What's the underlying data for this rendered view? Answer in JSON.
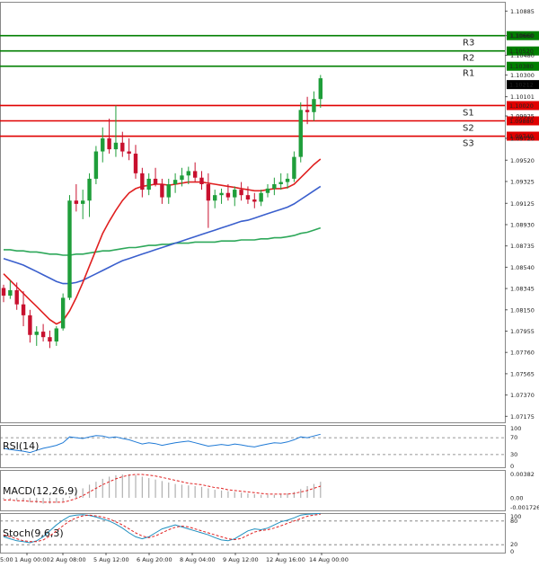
{
  "chart_data": {
    "type": "candlestick",
    "symbol": "EUR/USD",
    "y_ticks": [
      "1.10885",
      "1.10660",
      "1.10480",
      "1.10300",
      "1.10101",
      "1.09925",
      "1.09720",
      "1.09520",
      "1.09325",
      "1.09125",
      "1.08930",
      "1.08735",
      "1.08540",
      "1.08345",
      "1.08150",
      "1.07955",
      "1.07760",
      "1.07565",
      "1.07370",
      "1.07175"
    ],
    "x_ticks": [
      "1 Aug 00:00",
      "2 Aug 08:00",
      "5 Aug 12:00",
      "6 Aug 20:00",
      "8 Aug 04:00",
      "9 Aug 12:00",
      "12 Aug 16:00",
      "14 Aug 00:00"
    ],
    "x_tick_partial": "5:00",
    "ylim": [
      1.0712,
      1.1097
    ],
    "candles": [
      [
        1.0835,
        1.0838,
        1.0822,
        1.0828
      ],
      [
        1.0828,
        1.0842,
        1.0825,
        1.0833
      ],
      [
        1.0833,
        1.084,
        1.0815,
        1.082
      ],
      [
        1.082,
        1.0832,
        1.08,
        1.081
      ],
      [
        1.081,
        1.0815,
        1.0785,
        1.0792
      ],
      [
        1.0792,
        1.08,
        1.0782,
        1.0795
      ],
      [
        1.0795,
        1.0802,
        1.0786,
        1.079
      ],
      [
        1.079,
        1.0796,
        1.078,
        1.0786
      ],
      [
        1.0786,
        1.08,
        1.0782,
        1.0798
      ],
      [
        1.0798,
        1.083,
        1.0796,
        1.0826
      ],
      [
        1.0826,
        1.092,
        1.0824,
        1.0915
      ],
      [
        1.0915,
        1.093,
        1.0905,
        1.0912
      ],
      [
        1.0912,
        1.0925,
        1.0898,
        1.0915
      ],
      [
        1.0915,
        1.094,
        1.09,
        1.0935
      ],
      [
        1.0935,
        1.0965,
        1.093,
        1.096
      ],
      [
        1.096,
        1.0982,
        1.095,
        1.0972
      ],
      [
        1.0972,
        1.099,
        1.0958,
        1.0962
      ],
      [
        1.0962,
        1.1002,
        1.0955,
        1.0968
      ],
      [
        1.0968,
        1.0978,
        1.0955,
        1.096
      ],
      [
        1.096,
        1.0972,
        1.0952,
        1.0958
      ],
      [
        1.0958,
        1.0966,
        1.0935,
        1.094
      ],
      [
        1.094,
        1.0945,
        1.0918,
        1.0925
      ],
      [
        1.0925,
        1.094,
        1.092,
        1.0935
      ],
      [
        1.0935,
        1.0945,
        1.0928,
        1.093
      ],
      [
        1.093,
        1.0935,
        1.0912,
        1.0918
      ],
      [
        1.0918,
        1.0935,
        1.0912,
        1.093
      ],
      [
        1.093,
        1.094,
        1.0922,
        1.0934
      ],
      [
        1.0934,
        1.0945,
        1.0928,
        1.0938
      ],
      [
        1.0938,
        1.0946,
        1.093,
        1.0942
      ],
      [
        1.0942,
        1.095,
        1.0932,
        1.0936
      ],
      [
        1.0936,
        1.0942,
        1.0925,
        1.093
      ],
      [
        1.093,
        1.094,
        1.089,
        1.0915
      ],
      [
        1.0915,
        1.0925,
        1.0908,
        1.092
      ],
      [
        1.092,
        1.0926,
        1.0912,
        1.0922
      ],
      [
        1.0922,
        1.093,
        1.0915,
        1.0918
      ],
      [
        1.0918,
        1.0928,
        1.091,
        1.0925
      ],
      [
        1.0925,
        1.0932,
        1.0915,
        1.092
      ],
      [
        1.092,
        1.0928,
        1.0912,
        1.0916
      ],
      [
        1.0916,
        1.0922,
        1.0908,
        1.0914
      ],
      [
        1.0914,
        1.0925,
        1.091,
        1.0922
      ],
      [
        1.0922,
        1.093,
        1.0918,
        1.0926
      ],
      [
        1.0926,
        1.0936,
        1.092,
        1.093
      ],
      [
        1.093,
        1.094,
        1.0925,
        1.0932
      ],
      [
        1.0932,
        1.094,
        1.0926,
        1.0935
      ],
      [
        1.0935,
        1.096,
        1.0932,
        1.0955
      ],
      [
        1.0955,
        1.1005,
        1.095,
        1.0998
      ],
      [
        1.0998,
        1.101,
        1.0985,
        1.0996
      ],
      [
        1.0996,
        1.1015,
        1.0988,
        1.1008
      ],
      [
        1.1008,
        1.103,
        1.1,
        1.1027
      ]
    ],
    "sma_red": [
      1.0848,
      1.0842,
      1.0836,
      1.083,
      1.0824,
      1.0818,
      1.0812,
      1.0806,
      1.0802,
      1.0805,
      1.0814,
      1.0826,
      1.084,
      1.0855,
      1.087,
      1.0885,
      1.0896,
      1.0906,
      1.0915,
      1.0922,
      1.0926,
      1.0928,
      1.0929,
      1.093,
      1.093,
      1.0929,
      1.093,
      1.0931,
      1.0932,
      1.0932,
      1.0932,
      1.0931,
      1.093,
      1.0929,
      1.0928,
      1.0927,
      1.0926,
      1.0925,
      1.0924,
      1.0924,
      1.0925,
      1.0926,
      1.0926,
      1.0927,
      1.093,
      1.0936,
      1.0942,
      1.0948,
      1.0953
    ],
    "sma_blue": [
      1.0862,
      1.086,
      1.0858,
      1.0856,
      1.0853,
      1.085,
      1.0847,
      1.0844,
      1.0841,
      1.0839,
      1.0839,
      1.084,
      1.0842,
      1.0845,
      1.0848,
      1.0851,
      1.0854,
      1.0857,
      1.086,
      1.0862,
      1.0864,
      1.0866,
      1.0868,
      1.087,
      1.0872,
      1.0874,
      1.0876,
      1.0878,
      1.088,
      1.0882,
      1.0884,
      1.0886,
      1.0888,
      1.089,
      1.0892,
      1.0894,
      1.0896,
      1.0897,
      1.0899,
      1.0901,
      1.0903,
      1.0905,
      1.0907,
      1.0909,
      1.0912,
      1.0916,
      1.092,
      1.0924,
      1.0928
    ],
    "sma_green": [
      1.087,
      1.087,
      1.0869,
      1.0869,
      1.0868,
      1.0868,
      1.0867,
      1.0866,
      1.0866,
      1.0865,
      1.0865,
      1.0866,
      1.0866,
      1.0867,
      1.0868,
      1.0869,
      1.0869,
      1.087,
      1.0871,
      1.0872,
      1.0872,
      1.0873,
      1.0874,
      1.0874,
      1.0875,
      1.0875,
      1.0876,
      1.0876,
      1.0876,
      1.0877,
      1.0877,
      1.0877,
      1.0877,
      1.0878,
      1.0878,
      1.0878,
      1.0879,
      1.0879,
      1.0879,
      1.088,
      1.088,
      1.0881,
      1.0881,
      1.0882,
      1.0883,
      1.0885,
      1.0886,
      1.0888,
      1.089
    ],
    "levels": [
      {
        "name": "R3",
        "value": 1.1066,
        "tag": "1.10660",
        "color": "#007f00"
      },
      {
        "name": "R2",
        "value": 1.1052,
        "tag": "1.10520",
        "color": "#007f00"
      },
      {
        "name": "R1",
        "value": 1.1038,
        "tag": "1.10380",
        "color": "#007f00"
      },
      {
        "name": "S1",
        "value": 1.1002,
        "tag": "1.10020",
        "color": "#e00000"
      },
      {
        "name": "S2",
        "value": 1.0988,
        "tag": "1.09880",
        "color": "#e00000"
      },
      {
        "name": "S3",
        "value": 1.0974,
        "tag": "1.09740",
        "color": "#e00000"
      }
    ],
    "current_price": {
      "value": 1.10212,
      "tag": "1.10212"
    },
    "rsi": {
      "label": "RSI(14)",
      "ticks": [
        "100",
        "70",
        "30",
        "0"
      ],
      "values": [
        45,
        42,
        40,
        38,
        35,
        40,
        45,
        48,
        52,
        58,
        72,
        70,
        68,
        72,
        75,
        74,
        70,
        72,
        68,
        65,
        60,
        55,
        58,
        56,
        52,
        55,
        58,
        60,
        62,
        58,
        54,
        50,
        52,
        54,
        52,
        55,
        53,
        50,
        48,
        52,
        55,
        58,
        57,
        60,
        65,
        72,
        70,
        74,
        78
      ]
    },
    "macd": {
      "label": "MACD(12,26,9)",
      "ticks": [
        "0.00382",
        "0.00",
        "-0.001726"
      ],
      "hist": [
        -0.0002,
        -0.0003,
        -0.0004,
        -0.0005,
        -0.0006,
        -0.0007,
        -0.0008,
        -0.0008,
        -0.0007,
        -0.0005,
        0.0002,
        0.0008,
        0.0013,
        0.0018,
        0.0022,
        0.0026,
        0.0029,
        0.0031,
        0.0032,
        0.0032,
        0.0031,
        0.0029,
        0.0027,
        0.0025,
        0.0023,
        0.0021,
        0.0019,
        0.0018,
        0.0017,
        0.0016,
        0.0015,
        0.0013,
        0.0011,
        0.001,
        0.0009,
        0.0008,
        0.0007,
        0.0006,
        0.0005,
        0.0004,
        0.0004,
        0.0004,
        0.0005,
        0.0006,
        0.0008,
        0.0012,
        0.0016,
        0.0019,
        0.0022
      ],
      "signal": [
        -0.0003,
        -0.0003,
        -0.0004,
        -0.0004,
        -0.0005,
        -0.0005,
        -0.0006,
        -0.0006,
        -0.0006,
        -0.0006,
        -0.0004,
        -0.0001,
        0.0003,
        0.0008,
        0.0013,
        0.0018,
        0.0022,
        0.0026,
        0.0029,
        0.0031,
        0.0032,
        0.0032,
        0.0031,
        0.003,
        0.0028,
        0.0026,
        0.0024,
        0.0022,
        0.002,
        0.0019,
        0.0018,
        0.0016,
        0.0014,
        0.0013,
        0.0011,
        0.001,
        0.0009,
        0.0008,
        0.0007,
        0.0006,
        0.0005,
        0.0005,
        0.0005,
        0.0005,
        0.0006,
        0.0008,
        0.001,
        0.0013,
        0.0016
      ]
    },
    "stoch": {
      "label": "Stoch(9,6,3)",
      "ticks": [
        "100",
        "80",
        "20",
        "0"
      ],
      "k": [
        40,
        35,
        30,
        28,
        25,
        30,
        40,
        55,
        70,
        82,
        92,
        95,
        96,
        94,
        90,
        85,
        80,
        72,
        62,
        50,
        40,
        35,
        40,
        50,
        60,
        65,
        70,
        65,
        60,
        55,
        50,
        45,
        38,
        32,
        30,
        35,
        45,
        55,
        60,
        58,
        62,
        70,
        78,
        82,
        88,
        95,
        97,
        98,
        99
      ],
      "d": [
        45,
        40,
        35,
        30,
        28,
        28,
        32,
        42,
        55,
        68,
        80,
        88,
        93,
        95,
        93,
        90,
        85,
        78,
        70,
        60,
        50,
        42,
        38,
        42,
        50,
        58,
        64,
        67,
        65,
        60,
        55,
        50,
        45,
        40,
        35,
        33,
        36,
        44,
        52,
        56,
        58,
        62,
        68,
        74,
        80,
        86,
        92,
        95,
        97
      ]
    }
  }
}
